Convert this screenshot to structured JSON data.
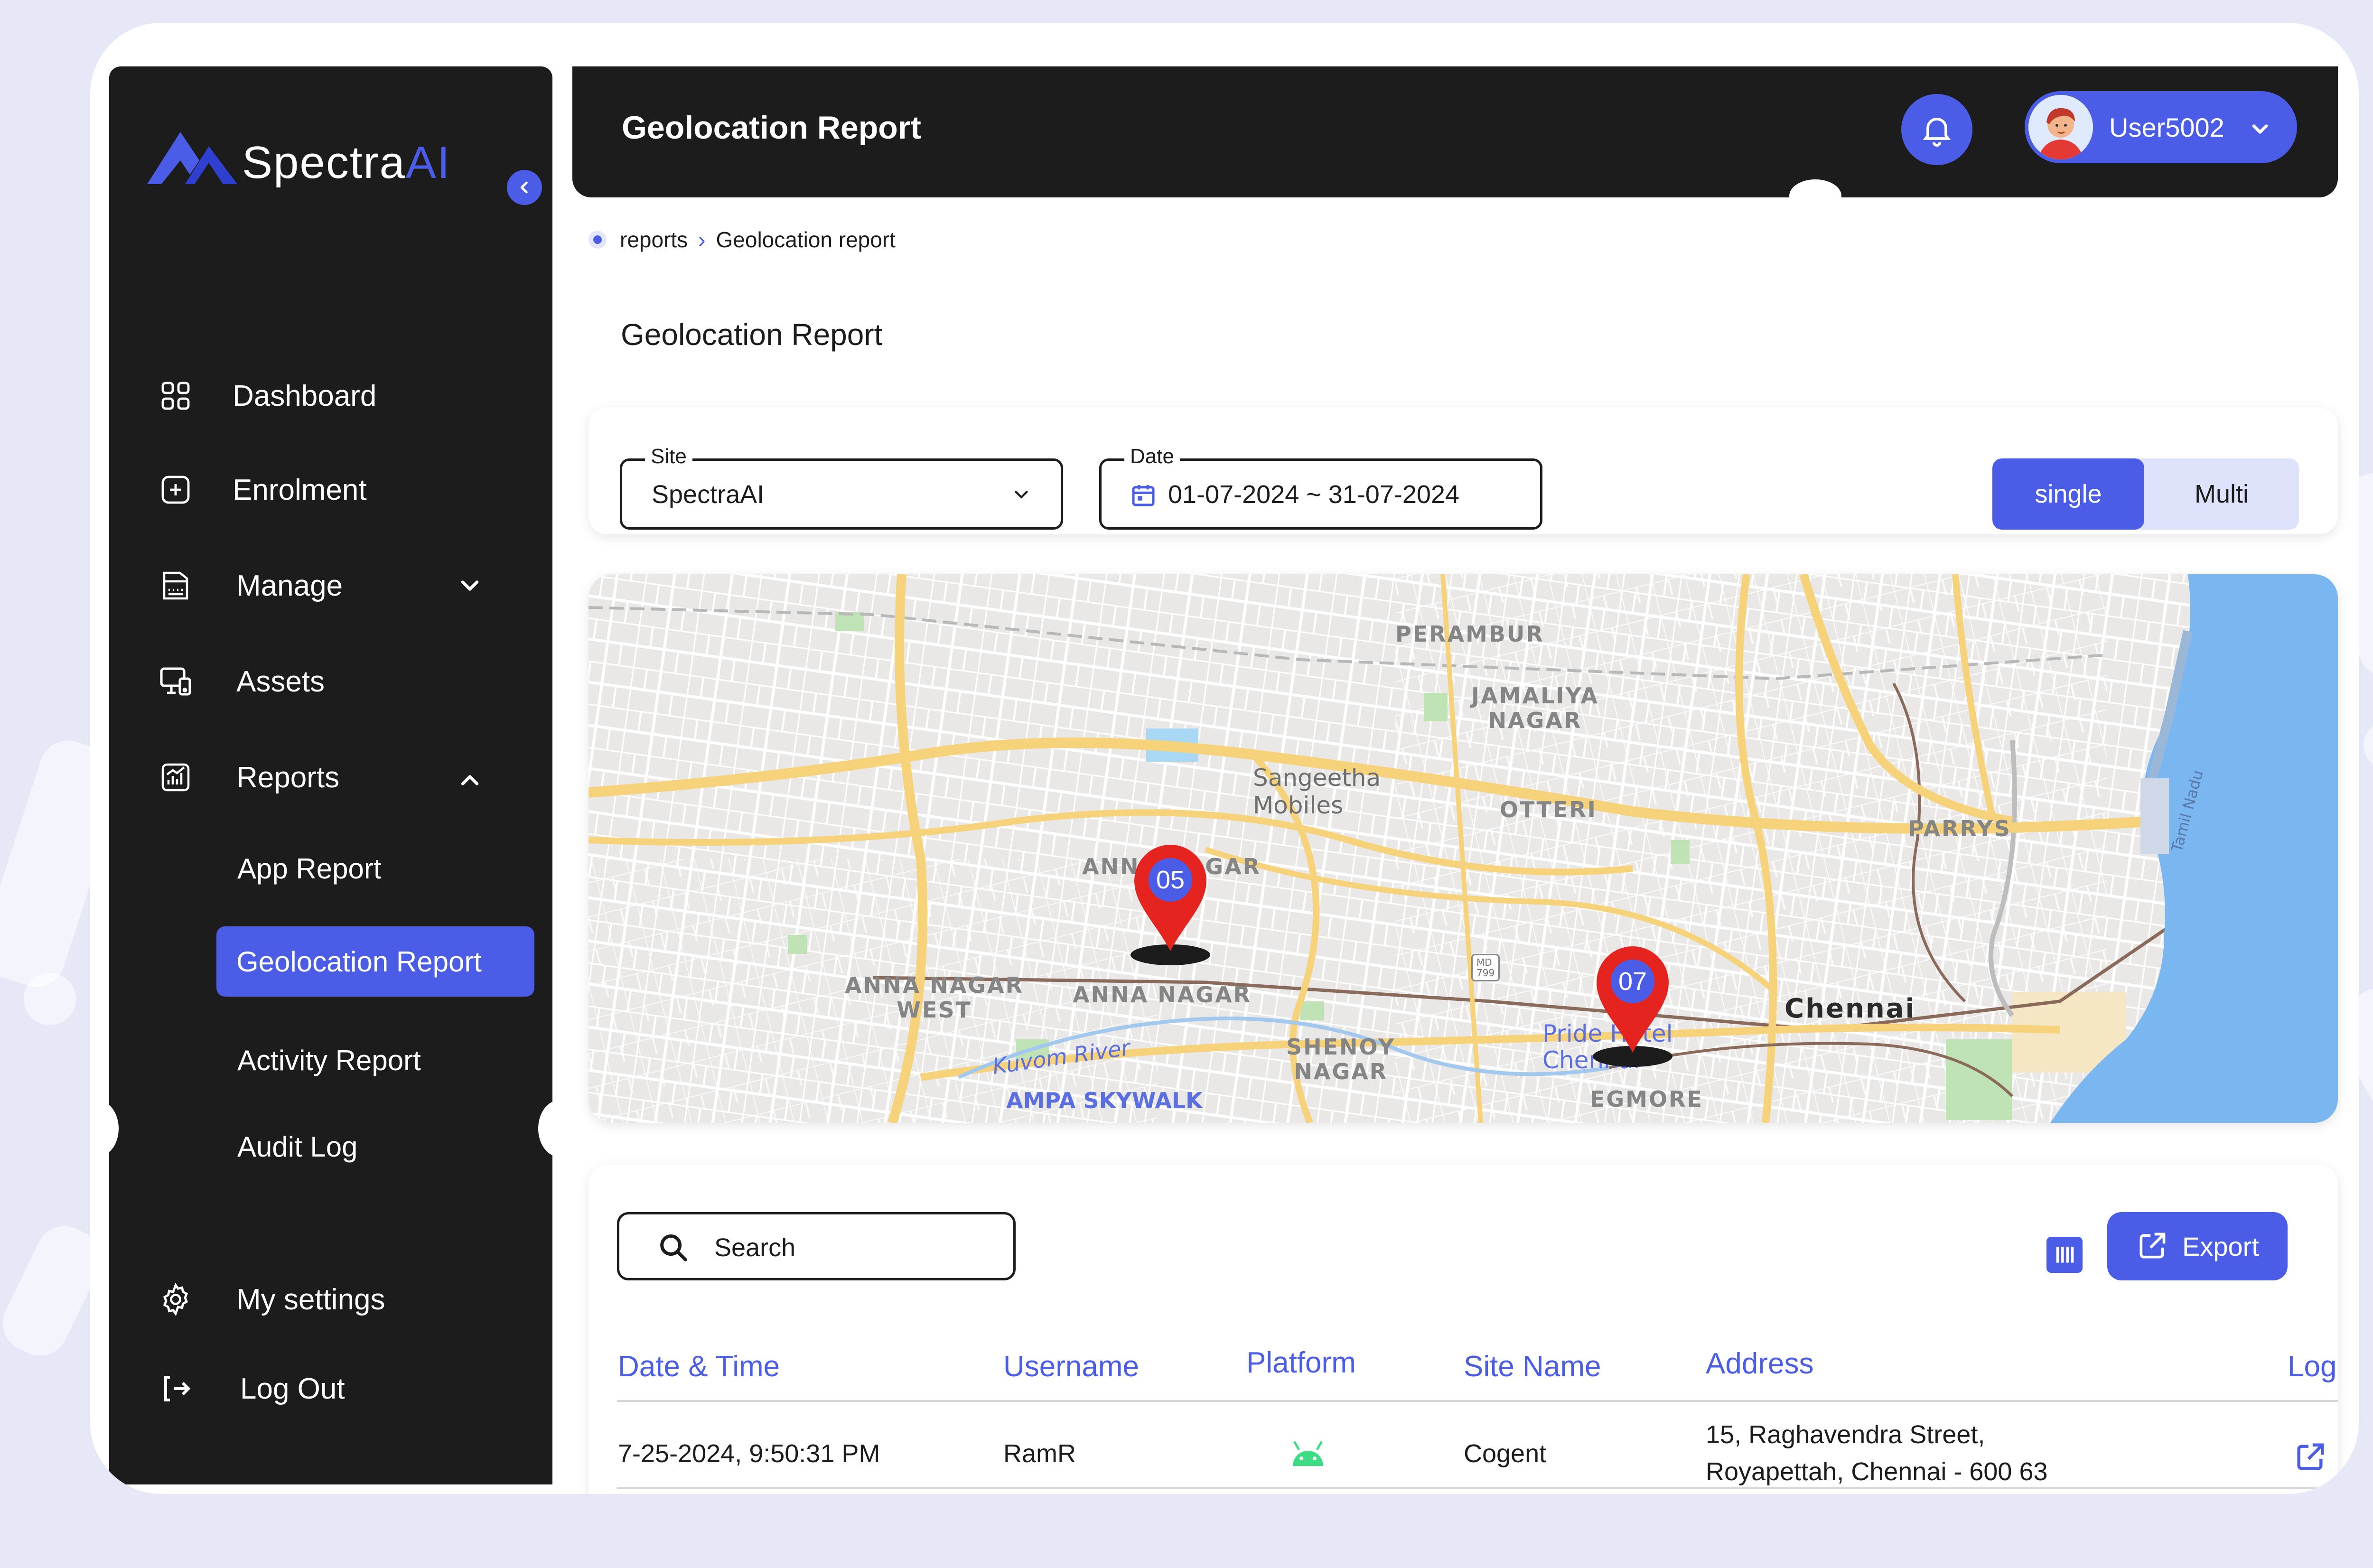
{
  "app": {
    "name_main": "Spectra",
    "name_accent": "AI"
  },
  "header": {
    "title": "Geolocation Report",
    "username": "User5002"
  },
  "sidebar": {
    "items": [
      {
        "label": "Dashboard",
        "icon": "dashboard-grid-icon"
      },
      {
        "label": "Enrolment",
        "icon": "plus-square-icon"
      },
      {
        "label": "Manage",
        "icon": "keyboard-icon"
      },
      {
        "label": "Assets",
        "icon": "devices-icon"
      },
      {
        "label": "Reports",
        "icon": "chart-report-icon"
      }
    ],
    "reports_sub": [
      "App Report",
      "Geolocation Report",
      "Activity Report",
      "Audit Log"
    ],
    "bottom": [
      {
        "label": "My settings",
        "icon": "gear-icon"
      },
      {
        "label": "Log Out",
        "icon": "logout-icon"
      }
    ]
  },
  "breadcrumb": {
    "parent": "reports",
    "current": "Geolocation report"
  },
  "page": {
    "title": "Geolocation Report"
  },
  "filters": {
    "site": {
      "label": "Site",
      "value": "SpectraAI"
    },
    "date": {
      "label": "Date",
      "value": "01-07-2024 ~ 31-07-2024"
    },
    "mode": {
      "options": [
        "single",
        "Multi"
      ],
      "selected": "single"
    }
  },
  "map": {
    "labels": {
      "perambur": "PERAMBUR",
      "jamaliya": "JAMALIYA\nNAGAR",
      "sangeetha": "Sangeetha\nMobiles",
      "otteri": "OTTERI",
      "parrys": "PARRYS",
      "anna_nagar_top": "ANNA NAGAR",
      "anna_nagar_west": "ANNA NAGAR\nWEST",
      "anna_nagar": "ANNA NAGAR",
      "shenoy": "SHENOY\nNAGAR",
      "egmore": "EGMORE",
      "chennai": "Chennai",
      "kuvom": "Kuvom River",
      "ampa": "AMPA SKYWALK",
      "pride": "Pride Hotel\nChennai",
      "md": "MD\n799",
      "tamil": "Tamil Nadu"
    },
    "markers": [
      {
        "count": "05"
      },
      {
        "count": "07"
      }
    ]
  },
  "table": {
    "search_placeholder": "Search",
    "export_label": "Export",
    "columns": [
      "Date & Time",
      "Username",
      "Platform",
      "Site Name",
      "Address",
      "Log"
    ],
    "rows": [
      {
        "datetime": "7-25-2024, 9:50:31 PM",
        "username": "RamR",
        "platform": "android-icon",
        "site": "Cogent",
        "address_line1": "15, Raghavendra Street,",
        "address_line2": "Royapettah, Chennai - 600 63"
      }
    ]
  },
  "colors": {
    "accent": "#4b5ce6",
    "dark": "#1c1c1c",
    "map_water": "#7ab6f0",
    "map_road": "#f6d27a",
    "pin_red": "#e5241f",
    "android_green": "#3ddc84"
  }
}
